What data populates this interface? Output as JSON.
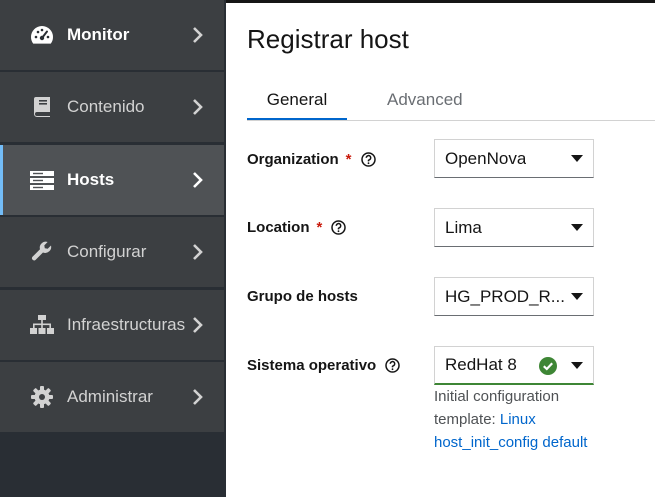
{
  "sidebar": {
    "items": [
      {
        "label": "Monitor",
        "icon": "dashboard-icon"
      },
      {
        "label": "Contenido",
        "icon": "book-icon"
      },
      {
        "label": "Hosts",
        "icon": "server-icon",
        "active": true
      },
      {
        "label": "Configurar",
        "icon": "wrench-icon"
      },
      {
        "label": "Infraestructuras",
        "icon": "network-icon"
      },
      {
        "label": "Administrar",
        "icon": "gear-icon"
      }
    ]
  },
  "main": {
    "title": "Registrar host",
    "tabs": [
      {
        "label": "General",
        "selected": true
      },
      {
        "label": "Advanced",
        "selected": false
      }
    ],
    "fields": {
      "organization": {
        "label": "Organization",
        "required": "*",
        "value": "OpenNova"
      },
      "location": {
        "label": "Location",
        "required": "*",
        "value": "Lima"
      },
      "host_group": {
        "label": "Grupo de hosts",
        "value": "HG_PROD_R..."
      },
      "os": {
        "label": "Sistema operativo",
        "value": "RedHat 8"
      }
    },
    "helper": {
      "prefix": "Initial configuration template:",
      "link": "Linux host_init_config default"
    }
  },
  "colors": {
    "sidebar_bg": "#292e34",
    "accent_blue": "#0066cc",
    "active_indicator": "#73bcf7",
    "success_green": "#3e8635",
    "required_red": "#c9190b"
  }
}
